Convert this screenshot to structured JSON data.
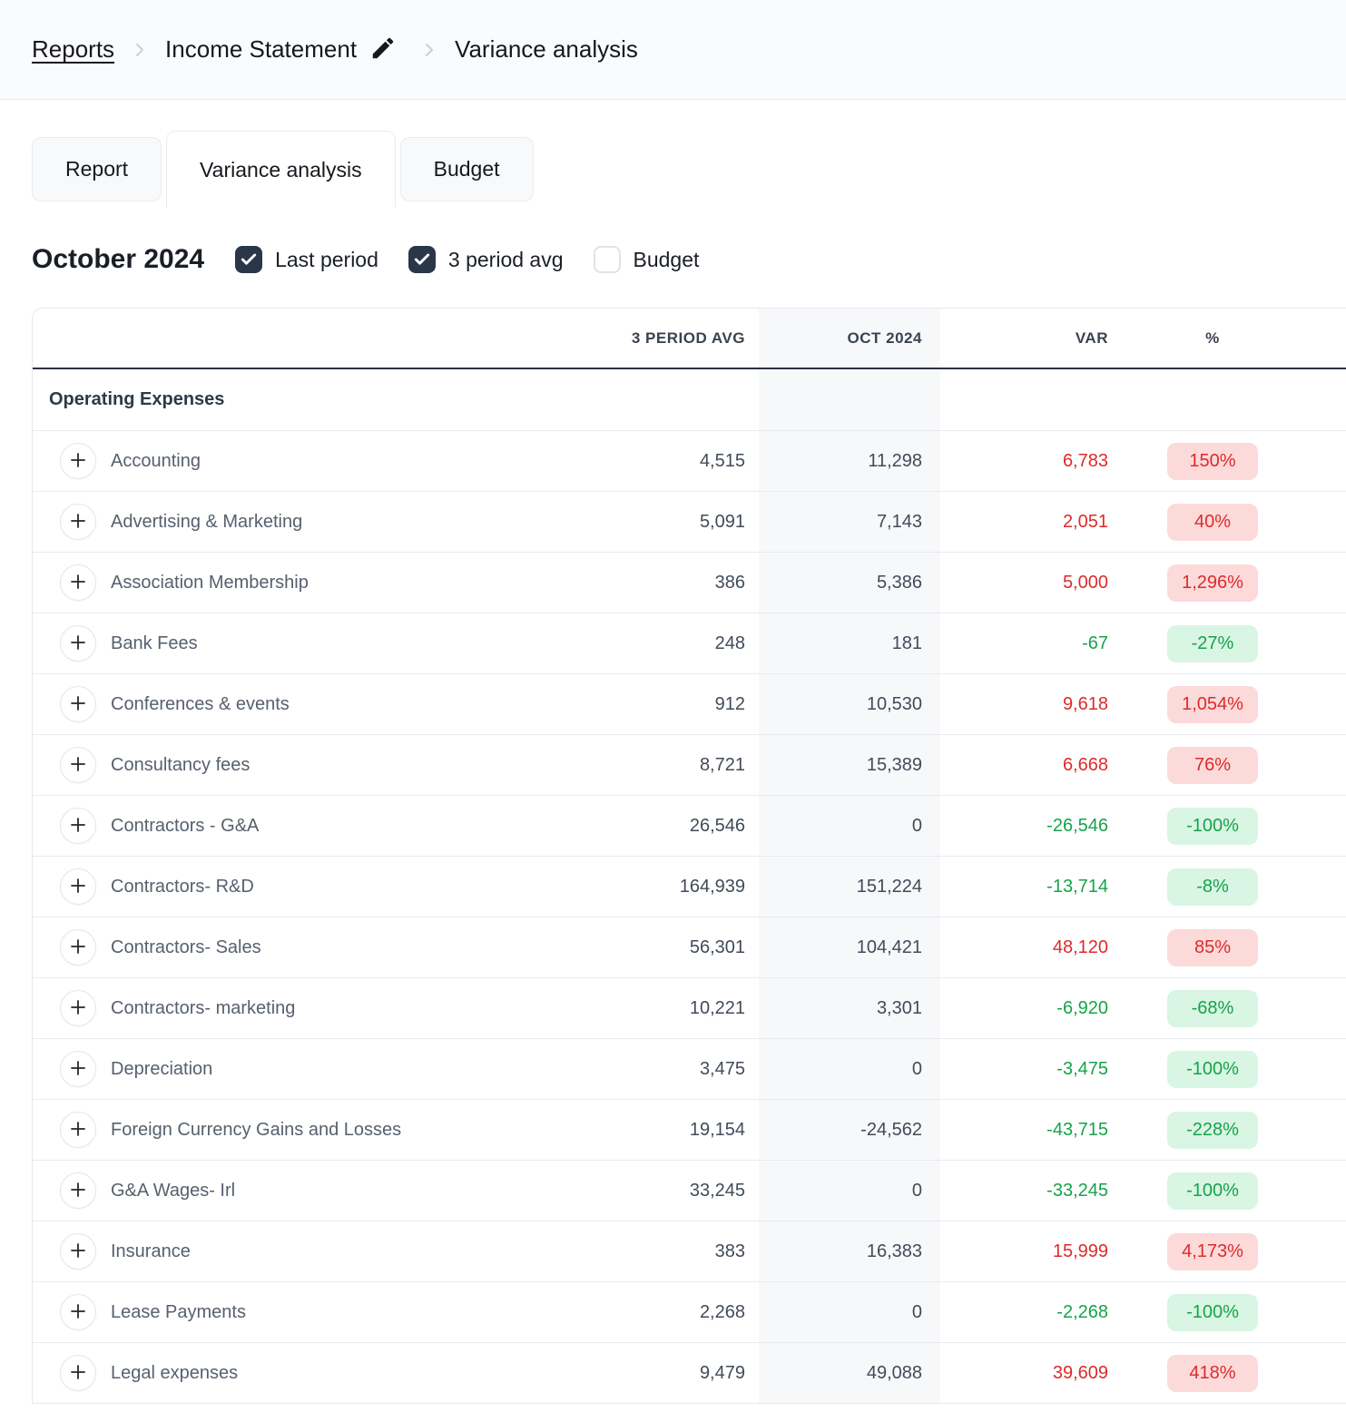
{
  "breadcrumb": {
    "reports": "Reports",
    "report_name": "Income Statement",
    "page": "Variance analysis"
  },
  "tabs": [
    {
      "label": "Report",
      "active": false
    },
    {
      "label": "Variance analysis",
      "active": true
    },
    {
      "label": "Budget",
      "active": false
    }
  ],
  "period_title": "October 2024",
  "filters": [
    {
      "label": "Last period",
      "checked": true
    },
    {
      "label": "3 period avg",
      "checked": true
    },
    {
      "label": "Budget",
      "checked": false
    }
  ],
  "table": {
    "headers": {
      "avg": "3 PERIOD AVG",
      "oct": "OCT 2024",
      "var": "VAR",
      "pct": "%"
    },
    "section_title": "Operating Expenses",
    "rows": [
      {
        "label": "Accounting",
        "avg": "4,515",
        "oct": "11,298",
        "var": "6,783",
        "pct": "150%",
        "trend": "increase"
      },
      {
        "label": "Advertising & Marketing",
        "avg": "5,091",
        "oct": "7,143",
        "var": "2,051",
        "pct": "40%",
        "trend": "increase"
      },
      {
        "label": "Association Membership",
        "avg": "386",
        "oct": "5,386",
        "var": "5,000",
        "pct": "1,296%",
        "trend": "increase"
      },
      {
        "label": "Bank Fees",
        "avg": "248",
        "oct": "181",
        "var": "-67",
        "pct": "-27%",
        "trend": "decrease"
      },
      {
        "label": "Conferences & events",
        "avg": "912",
        "oct": "10,530",
        "var": "9,618",
        "pct": "1,054%",
        "trend": "increase"
      },
      {
        "label": "Consultancy fees",
        "avg": "8,721",
        "oct": "15,389",
        "var": "6,668",
        "pct": "76%",
        "trend": "increase"
      },
      {
        "label": "Contractors - G&A",
        "avg": "26,546",
        "oct": "0",
        "var": "-26,546",
        "pct": "-100%",
        "trend": "decrease"
      },
      {
        "label": "Contractors- R&D",
        "avg": "164,939",
        "oct": "151,224",
        "var": "-13,714",
        "pct": "-8%",
        "trend": "decrease"
      },
      {
        "label": "Contractors- Sales",
        "avg": "56,301",
        "oct": "104,421",
        "var": "48,120",
        "pct": "85%",
        "trend": "increase"
      },
      {
        "label": "Contractors- marketing",
        "avg": "10,221",
        "oct": "3,301",
        "var": "-6,920",
        "pct": "-68%",
        "trend": "decrease"
      },
      {
        "label": "Depreciation",
        "avg": "3,475",
        "oct": "0",
        "var": "-3,475",
        "pct": "-100%",
        "trend": "decrease"
      },
      {
        "label": "Foreign Currency Gains and Losses",
        "avg": "19,154",
        "oct": "-24,562",
        "var": "-43,715",
        "pct": "-228%",
        "trend": "decrease"
      },
      {
        "label": "G&A Wages- Irl",
        "avg": "33,245",
        "oct": "0",
        "var": "-33,245",
        "pct": "-100%",
        "trend": "decrease"
      },
      {
        "label": "Insurance",
        "avg": "383",
        "oct": "16,383",
        "var": "15,999",
        "pct": "4,173%",
        "trend": "increase"
      },
      {
        "label": "Lease Payments",
        "avg": "2,268",
        "oct": "0",
        "var": "-2,268",
        "pct": "-100%",
        "trend": "decrease"
      },
      {
        "label": "Legal expenses",
        "avg": "9,479",
        "oct": "49,088",
        "var": "39,609",
        "pct": "418%",
        "trend": "increase"
      }
    ]
  },
  "colors": {
    "accent_dark": "#2b3648",
    "header_underline": "#2b3245",
    "increase_text": "#dd2b2b",
    "increase_bg": "#fcdada",
    "decrease_text": "#16a34a",
    "decrease_bg": "#d9f5e3"
  }
}
